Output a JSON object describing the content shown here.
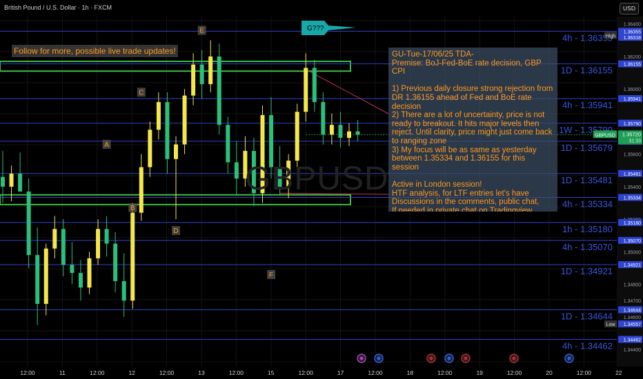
{
  "symbol_title": "British Pound / U.S. Dollar · 1h · FXCM",
  "currency_button": "USD",
  "watermark": "GBPUSD",
  "follow_banner": "Follow for more, possible live trade updates!",
  "callout_label": "G???",
  "analysis_note": "GU-Tue-17/06/25 TDA-\nPremise: BoJ-Fed-BoE rate decision, GBP CPI\n\n1) Previous daily closure strong rejection from DR 1.36155 ahead of Fed and BoE rate decision\n2) There are a lot of uncertainty, price is not ready to breakout. It hits major levels then reject. Until clarity, price might just come back to ranging zone\n3) My focus will be as same as yesterday between 1.35334 and 1.36155 for this session\n\nActive in London session!\nHTF analysis, for LTF entries let's have\nDiscussions in the comments, public chat,\nIf needed in private chat on Tradingview\nNot financial advice, DYOR.\nMarket flow strategy\nMister Y",
  "colors": {
    "background": "#000000",
    "bull": "#f5e64a",
    "bear": "#2bbf7a",
    "level_line": "#2f45d0",
    "zone": "#3dbf45",
    "text_orange": "#ff9a1f",
    "level_text": "#3a56e0",
    "current_price_tag": "#1e9e56",
    "callout": "#18a8a8"
  },
  "chart_data": {
    "type": "candlestick",
    "y_range": [
      1.3432,
      1.3642
    ],
    "x_labels": [
      "12:00",
      "11",
      "12:00",
      "12",
      "12:00",
      "13",
      "12:00",
      "15",
      "12:00",
      "17",
      "12:00",
      "18",
      "12:00",
      "19",
      "12:00",
      "20",
      "12:00",
      "22"
    ],
    "y_ticks": [
      "1.36400",
      "1.36200",
      "1.36000",
      "1.35800",
      "1.35600",
      "1.35400",
      "1.35200",
      "1.35000",
      "1.34800",
      "1.34700",
      "1.34600",
      "1.34400"
    ],
    "levels": [
      {
        "label": "4h - 1.36355",
        "price": 1.36355
      },
      {
        "label": "1D - 1.36155",
        "price": 1.36155
      },
      {
        "label": "4h - 1.35941",
        "price": 1.35941
      },
      {
        "label": "1W - 1.35790",
        "price": 1.3579
      },
      {
        "label": "1D - 1.35679",
        "price": 1.35679
      },
      {
        "label": "1D - 1.35481",
        "price": 1.35481
      },
      {
        "label": "4h - 1.35334",
        "price": 1.35334
      },
      {
        "label": "1h - 1.35180",
        "price": 1.3518
      },
      {
        "label": "4h - 1.35070",
        "price": 1.3507
      },
      {
        "label": "1D - 1.34921",
        "price": 1.34921
      },
      {
        "label": "1D - 1.34644",
        "price": 1.34644
      },
      {
        "label": "4h - 1.34462",
        "price": 1.34462
      }
    ],
    "axis_tags": [
      {
        "text": "1.36355",
        "price": 1.36355
      },
      {
        "text": "1.36318",
        "price": 1.36318
      },
      {
        "text": "1.36155",
        "price": 1.36155
      },
      {
        "text": "1.35941",
        "price": 1.35941
      },
      {
        "text": "1.35790",
        "price": 1.3579
      },
      {
        "text": "1.35679",
        "price": 1.35679
      },
      {
        "text": "1.35481",
        "price": 1.35481
      },
      {
        "text": "1.35334",
        "price": 1.35334
      },
      {
        "text": "1.35180",
        "price": 1.3518
      },
      {
        "text": "1.35070",
        "price": 1.3507
      },
      {
        "text": "1.34921",
        "price": 1.34921
      },
      {
        "text": "1.34644",
        "price": 1.34644
      },
      {
        "text": "1.34557",
        "price": 1.34557
      },
      {
        "text": "1.34462",
        "price": 1.34462
      }
    ],
    "high_label": "High",
    "low_label": "Low",
    "current_symbol": "GBPUSD",
    "current_price": "1.35720",
    "current_price_value": 1.3572,
    "countdown": "31:33",
    "zones": [
      {
        "price_top": 1.3617,
        "price_bottom": 1.3611
      },
      {
        "price_top": 1.3535,
        "price_bottom": 1.3529
      }
    ],
    "wave_labels": [
      {
        "text": "A",
        "price": 1.3565,
        "candle": 12
      },
      {
        "text": "B",
        "price": 1.3526,
        "candle": 15
      },
      {
        "text": "C",
        "price": 1.3597,
        "candle": 16
      },
      {
        "text": "D",
        "price": 1.3512,
        "candle": 20
      },
      {
        "text": "E",
        "price": 1.3635,
        "candle": 23
      },
      {
        "text": "F",
        "price": 1.3485,
        "candle": 31
      }
    ],
    "candles": [
      [
        1.3546,
        1.3562,
        1.353,
        1.354
      ],
      [
        1.354,
        1.3553,
        1.3531,
        1.3548
      ],
      [
        1.3548,
        1.3561,
        1.3541,
        1.3537
      ],
      [
        1.3537,
        1.3545,
        1.349,
        1.3498
      ],
      [
        1.3498,
        1.3515,
        1.3455,
        1.3468
      ],
      [
        1.3468,
        1.3505,
        1.3461,
        1.3502
      ],
      [
        1.3502,
        1.3522,
        1.3496,
        1.3514
      ],
      [
        1.3514,
        1.352,
        1.3485,
        1.3492
      ],
      [
        1.3492,
        1.3506,
        1.348,
        1.3487
      ],
      [
        1.3487,
        1.3495,
        1.347,
        1.3478
      ],
      [
        1.3478,
        1.35,
        1.3474,
        1.3496
      ],
      [
        1.3496,
        1.352,
        1.3492,
        1.3514
      ],
      [
        1.3514,
        1.3522,
        1.3497,
        1.3505
      ],
      [
        1.3505,
        1.3512,
        1.3475,
        1.3482
      ],
      [
        1.3482,
        1.3499,
        1.346,
        1.347
      ],
      [
        1.347,
        1.353,
        1.3465,
        1.3524
      ],
      [
        1.3524,
        1.356,
        1.3519,
        1.3552
      ],
      [
        1.3552,
        1.358,
        1.3546,
        1.3575
      ],
      [
        1.3575,
        1.3598,
        1.3569,
        1.3592
      ],
      [
        1.3592,
        1.3598,
        1.3548,
        1.3557
      ],
      [
        1.3557,
        1.3571,
        1.352,
        1.3566
      ],
      [
        1.3566,
        1.36,
        1.356,
        1.3596
      ],
      [
        1.3596,
        1.3622,
        1.359,
        1.3615
      ],
      [
        1.3615,
        1.3624,
        1.3594,
        1.3603
      ],
      [
        1.3603,
        1.363,
        1.3598,
        1.362
      ],
      [
        1.362,
        1.3628,
        1.3572,
        1.3578
      ],
      [
        1.3578,
        1.3583,
        1.3548,
        1.3555
      ],
      [
        1.3555,
        1.3568,
        1.3535,
        1.3545
      ],
      [
        1.3545,
        1.3571,
        1.354,
        1.3562
      ],
      [
        1.3562,
        1.357,
        1.3528,
        1.3536
      ],
      [
        1.3536,
        1.359,
        1.353,
        1.3584
      ],
      [
        1.3584,
        1.3595,
        1.3545,
        1.3552
      ],
      [
        1.3552,
        1.3565,
        1.3535,
        1.354
      ],
      [
        1.354,
        1.356,
        1.3533,
        1.3556
      ],
      [
        1.3556,
        1.3591,
        1.3552,
        1.3586
      ],
      [
        1.3586,
        1.3622,
        1.358,
        1.3613
      ],
      [
        1.3613,
        1.3618,
        1.3586,
        1.3592
      ],
      [
        1.3592,
        1.3598,
        1.3566,
        1.3572
      ],
      [
        1.3572,
        1.3585,
        1.3566,
        1.3578
      ],
      [
        1.3578,
        1.3586,
        1.3564,
        1.357
      ],
      [
        1.357,
        1.3579,
        1.3565,
        1.3574
      ],
      [
        1.3574,
        1.3581,
        1.3568,
        1.3572
      ]
    ]
  }
}
